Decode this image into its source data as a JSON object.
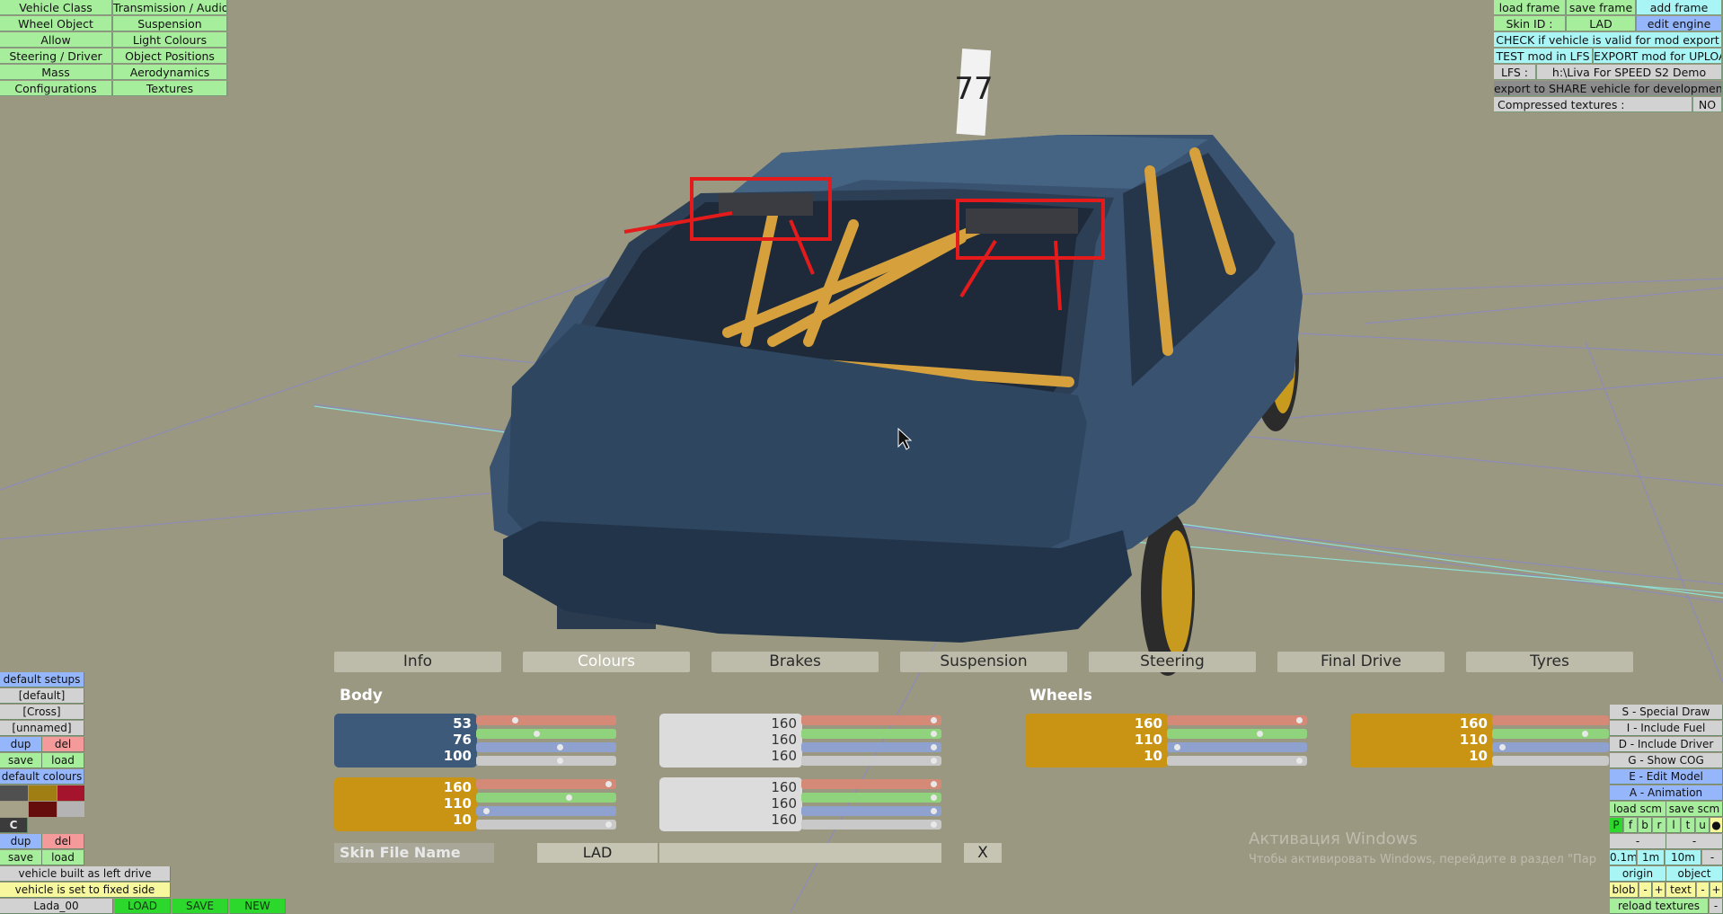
{
  "top_left_menu": [
    [
      "Vehicle Class",
      "Transmission / Audio"
    ],
    [
      "Wheel Object",
      "Suspension"
    ],
    [
      "Allow",
      "Light Colours"
    ],
    [
      "Steering / Driver",
      "Object Positions"
    ],
    [
      "Mass",
      "Aerodynamics"
    ],
    [
      "Configurations",
      "Textures"
    ]
  ],
  "top_right": {
    "load_frame": "load frame",
    "save_frame": "save frame",
    "add_frame": "add frame",
    "skin_id_label": "Skin ID :",
    "skin_id_value": "LAD",
    "edit_engine": "edit engine",
    "check_valid": "CHECK if vehicle is valid for mod export",
    "test_mod": "TEST mod in LFS",
    "export_mod": "EXPORT mod for UPLOAD",
    "lfs_label": "LFS :",
    "lfs_path": "h:\\Liva For SPEED S2 Demo",
    "export_share": "export to SHARE vehicle for development",
    "compressed_label": "Compressed textures :",
    "compressed_value": "NO"
  },
  "plate_number": "77",
  "tabs": [
    "Info",
    "Colours",
    "Brakes",
    "Suspension",
    "Steering",
    "Final Drive",
    "Tyres"
  ],
  "labels": {
    "body": "Body",
    "wheels": "Wheels"
  },
  "colour_swatches": {
    "body_main": [
      "53",
      "76",
      "100"
    ],
    "body_second": [
      "160",
      "160",
      "160"
    ],
    "body_third": [
      "160",
      "110",
      "10"
    ],
    "body_fourth": [
      "160",
      "160",
      "160"
    ],
    "wheels_main": [
      "160",
      "110",
      "10"
    ],
    "wheels_second": [
      "160",
      "110",
      "10"
    ]
  },
  "skin_row": {
    "placeholder": "Skin File Name",
    "value": "LAD",
    "close": "X"
  },
  "left_panel": {
    "default_setups": "default setups",
    "default": "[default]",
    "cross": "[Cross]",
    "unnamed": "[unnamed]",
    "dup": "dup",
    "del": "del",
    "save": "save",
    "load": "load",
    "default_colours": "default colours",
    "c": "C",
    "built_as": "vehicle built as left drive",
    "fixed_side": "vehicle is set to fixed side",
    "lada": "Lada_00",
    "load_btn": "LOAD",
    "save_btn": "SAVE",
    "new_btn": "NEW"
  },
  "right_panel": {
    "special_draw": "S - Special Draw",
    "include_fuel": "I - Include Fuel",
    "include_driver": "D - Include Driver",
    "show_cog": "G - Show COG",
    "edit_model": "E - Edit Model",
    "animation": "A - Animation",
    "load_scm": "load scm",
    "save_scm": "save scm",
    "letters": [
      "P",
      "f",
      "b",
      "r",
      "l",
      "t",
      "u"
    ],
    "dash1": "-",
    "dash2": "-",
    "step1": "0.1m",
    "step2": "1m",
    "step3": "10m",
    "dash3": "-",
    "origin": "origin",
    "object": "object",
    "blob": "blob",
    "minus": "-",
    "plus": "+",
    "text": "text",
    "reload": "reload textures"
  },
  "watermark": {
    "line1": "Активация Windows",
    "line2": "Чтобы активировать Windows, перейдите в раздел \"Пар"
  }
}
